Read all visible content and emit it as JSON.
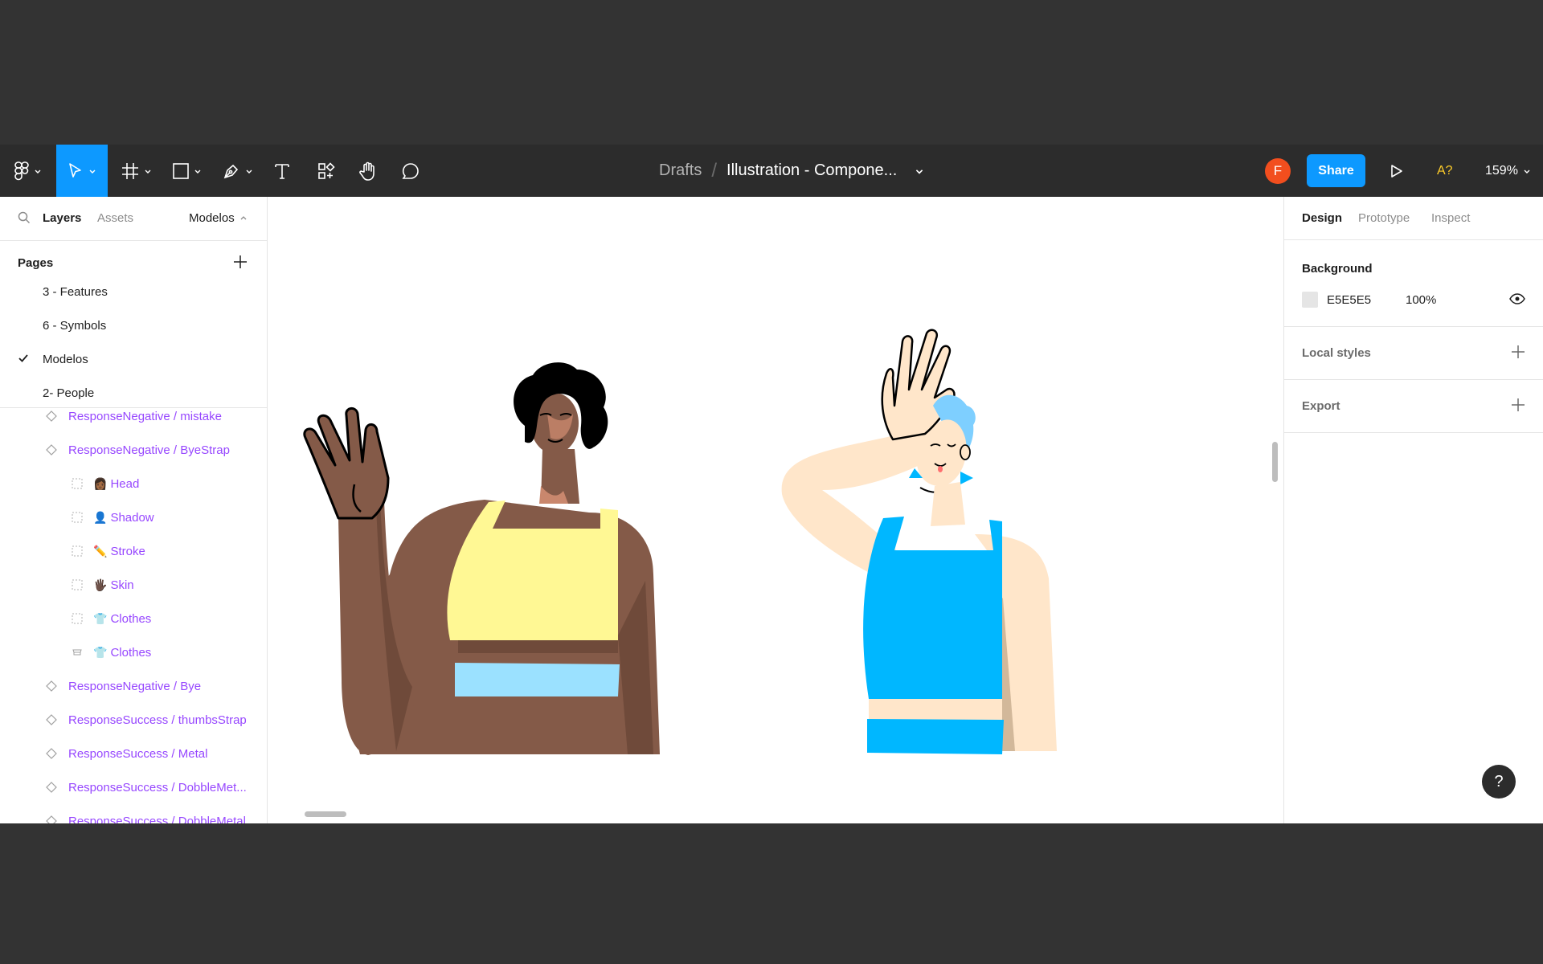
{
  "toolbar": {
    "breadcrumb_drafts": "Drafts",
    "breadcrumb_separator": "/",
    "file_name": "Illustration - Compone...",
    "avatar_initial": "F",
    "share_label": "Share",
    "a_badge": "A?",
    "zoom_label": "159%",
    "icons": [
      "figma-menu-icon",
      "move-tool-icon",
      "frame-tool-icon",
      "rectangle-tool-icon",
      "pen-tool-icon",
      "text-tool-icon",
      "resources-icon",
      "hand-tool-icon",
      "comment-icon",
      "present-play-icon"
    ]
  },
  "left_panel": {
    "tabs": {
      "layers": "Layers",
      "assets": "Assets"
    },
    "current_page": "Modelos",
    "pages_title": "Pages",
    "pages": [
      {
        "label": "3 - Features",
        "selected": false
      },
      {
        "label": "6 - Symbols",
        "selected": false
      },
      {
        "label": "Modelos",
        "selected": true
      },
      {
        "label": "2- People",
        "selected": false
      }
    ],
    "layers": [
      {
        "label": "ResponseNegative / mistake",
        "emoji": "",
        "type": "component",
        "indent": 0
      },
      {
        "label": "ResponseNegative / ByeStrap",
        "emoji": "",
        "type": "component",
        "indent": 0
      },
      {
        "label": "Head",
        "emoji": "👩🏾",
        "type": "frame",
        "indent": 1
      },
      {
        "label": "Shadow",
        "emoji": "👤",
        "type": "frame",
        "indent": 1
      },
      {
        "label": "Stroke",
        "emoji": "✏️",
        "type": "frame",
        "indent": 1
      },
      {
        "label": "Skin",
        "emoji": "🖐🏿",
        "type": "frame",
        "indent": 1
      },
      {
        "label": "Clothes",
        "emoji": "👕",
        "type": "frame",
        "indent": 1
      },
      {
        "label": "Clothes",
        "emoji": "👕",
        "type": "component-set",
        "indent": 1
      },
      {
        "label": "ResponseNegative / Bye",
        "emoji": "",
        "type": "component",
        "indent": 0
      },
      {
        "label": "ResponseSuccess / thumbsStrap",
        "emoji": "",
        "type": "component",
        "indent": 0
      },
      {
        "label": "ResponseSuccess / Metal",
        "emoji": "",
        "type": "component",
        "indent": 0
      },
      {
        "label": "ResponseSuccess / DobbleMet...",
        "emoji": "",
        "type": "component",
        "indent": 0
      },
      {
        "label": "ResponseSuccess / DobbleMetal",
        "emoji": "",
        "type": "component",
        "indent": 0
      }
    ]
  },
  "right_panel": {
    "tabs": {
      "design": "Design",
      "prototype": "Prototype",
      "inspect": "Inspect"
    },
    "background": {
      "title": "Background",
      "hex": "E5E5E5",
      "opacity": "100%",
      "swatch_color": "#E5E5E5"
    },
    "local_styles": "Local styles",
    "export": "Export",
    "help": "?"
  },
  "colors": {
    "accent": "#0D99FF",
    "toolbar_bg": "#2C2C2C",
    "component_purple": "#9747FF",
    "avatar": "#F24E1E",
    "skin_dark": "#845A48",
    "skin_light": "#FFE6CA",
    "top_yellow": "#FFF894",
    "top_blue": "#00B7FF",
    "shorts_light_blue": "#9BE1FF"
  }
}
